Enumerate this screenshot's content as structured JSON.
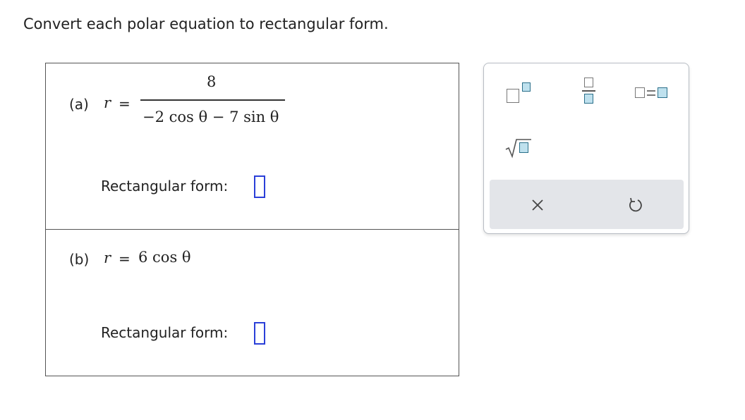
{
  "instruction": "Convert each polar equation to rectangular form.",
  "parts": [
    {
      "label": "(a)",
      "variable": "r",
      "equals": "=",
      "numerator": "8",
      "denominator": "−2 cos θ  −  7 sin θ",
      "answer_label": "Rectangular form:",
      "answer_value": ""
    },
    {
      "label": "(b)",
      "variable": "r",
      "equals": "=",
      "expression": "6 cos θ",
      "answer_label": "Rectangular form:",
      "answer_value": ""
    }
  ],
  "palette": {
    "buttons": [
      "superscript-button",
      "fraction-button",
      "equation-button",
      "square-root-button"
    ],
    "clear_symbol": "✕",
    "undo_symbol": "↺"
  },
  "colors": {
    "answer_box_border": "#2a3fd8",
    "template_fill": "#bfe1ee",
    "template_border": "#2a6f8a",
    "toolbar_bg": "#e3e5e9"
  }
}
